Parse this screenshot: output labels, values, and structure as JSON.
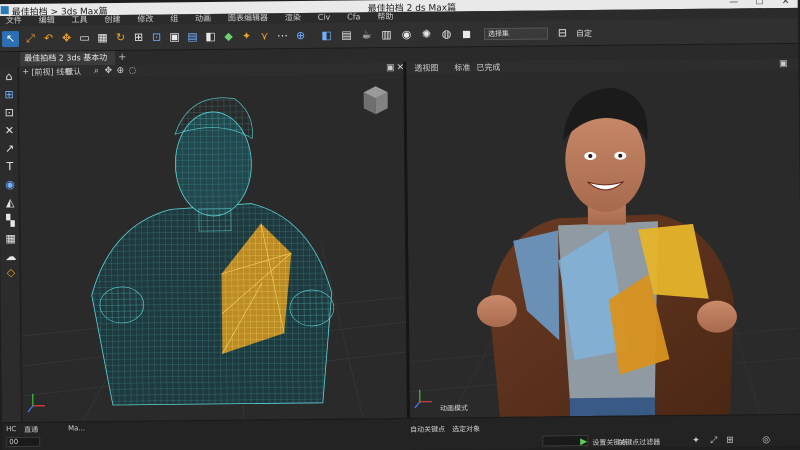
{
  "window": {
    "app_title_left": "最佳拍档 > 3ds Max篇",
    "title": "最佳拍档 2 ds Max篇"
  },
  "menu": [
    "文件",
    "编辑",
    "工具",
    "创建",
    "修改",
    "组",
    "动画",
    "图表编辑器",
    "渲染",
    "Civ",
    "Cfa",
    "帮助"
  ],
  "toolbar": {
    "selection_set": "选择集",
    "label_right": "自定"
  },
  "tabs": [
    {
      "label": "最佳拍档 2 3ds 基本功能"
    }
  ],
  "viewports": {
    "left": {
      "menu_plus": "+",
      "label": "[前视] 线框",
      "sub_items": [
        "默认",
        "L"
      ],
      "bottom_left": "HC",
      "bottom_mid": "直通",
      "bottom_right": "Ma..."
    },
    "right": {
      "label_1": "透视图",
      "label_2": "标准",
      "label_3": "已完成",
      "caption": "动画模式"
    }
  },
  "status": {
    "left_field": "00",
    "middle_a": "自动关键点",
    "middle_b": "选定对象",
    "right_a": "设置关键点",
    "right_b": "关键点过滤器"
  },
  "colors": {
    "accent": "#f2a326",
    "wire_cyan": "#5cd3d8",
    "wire_yellow": "#e6b42a"
  },
  "icons": [
    "select-icon",
    "link-icon",
    "move-icon",
    "rotate-icon",
    "scale-icon",
    "render-icon",
    "material-icon",
    "camera-icon",
    "light-icon",
    "teapot-icon",
    "view-cube-icon",
    "axis-gizmo-icon",
    "play-icon",
    "key-icon"
  ]
}
